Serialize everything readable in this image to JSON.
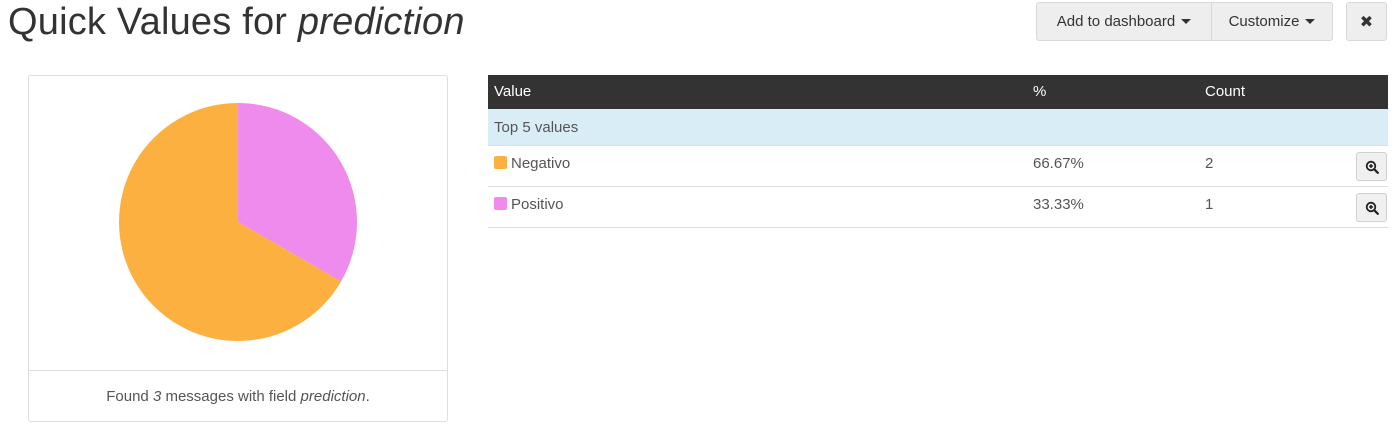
{
  "header": {
    "title_prefix": "Quick Values for ",
    "title_field": "prediction",
    "add_to_dashboard_label": "Add to dashboard",
    "customize_label": "Customize",
    "close_label": "✖"
  },
  "footer": {
    "prefix": "Found ",
    "count": "3",
    "middle": " messages with field ",
    "field": "prediction",
    "suffix": "."
  },
  "table": {
    "headers": {
      "value": "Value",
      "percent": "%",
      "count": "Count"
    },
    "group_label": "Top 5 values",
    "rows": [
      {
        "label": "Negativo",
        "percent": "66.67%",
        "count": "2",
        "color": "#fbb040"
      },
      {
        "label": "Positivo",
        "percent": "33.33%",
        "count": "1",
        "color": "#ee8bec"
      }
    ]
  },
  "chart_data": {
    "type": "pie",
    "slices": [
      {
        "label": "Negativo",
        "value": 2,
        "color": "#fbb040"
      },
      {
        "label": "Positivo",
        "value": 1,
        "color": "#ee8bec"
      }
    ]
  }
}
